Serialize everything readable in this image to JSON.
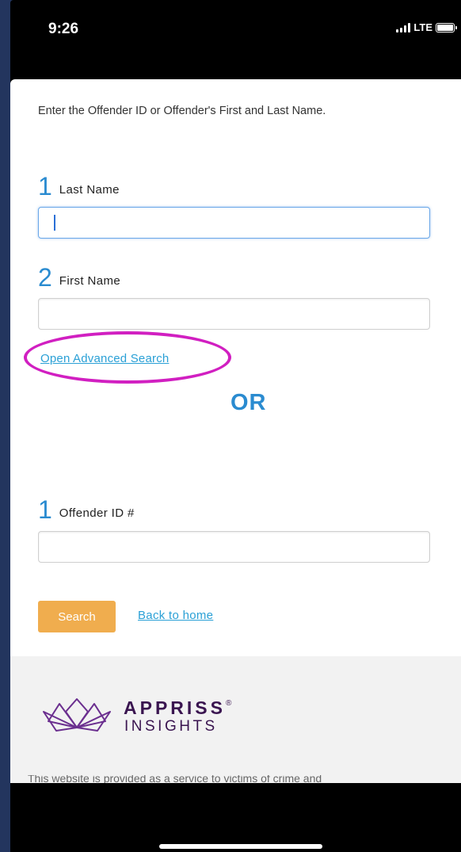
{
  "status": {
    "time": "9:26",
    "network": "LTE"
  },
  "form": {
    "intro": "Enter the Offender ID or Offender's First and Last Name.",
    "last_name": {
      "number": "1",
      "label": "Last Name",
      "value": ""
    },
    "first_name": {
      "number": "2",
      "label": "First Name",
      "value": ""
    },
    "advanced_link": "Open Advanced Search",
    "or_label": "OR",
    "offender_id": {
      "number": "1",
      "label": "Offender ID #",
      "value": ""
    },
    "search_button": "Search",
    "back_link": "Back to home"
  },
  "footer": {
    "logo_top": "APPRISS",
    "logo_registered": "®",
    "logo_bottom": "INSIGHTS",
    "text": "This website is provided as a service to victims of crime and"
  },
  "colors": {
    "accent_blue": "#2a8bd0",
    "link": "#2aa0d6",
    "search_button": "#f0ad4e",
    "annotation": "#d11fc1",
    "brand": "#3a1550"
  }
}
